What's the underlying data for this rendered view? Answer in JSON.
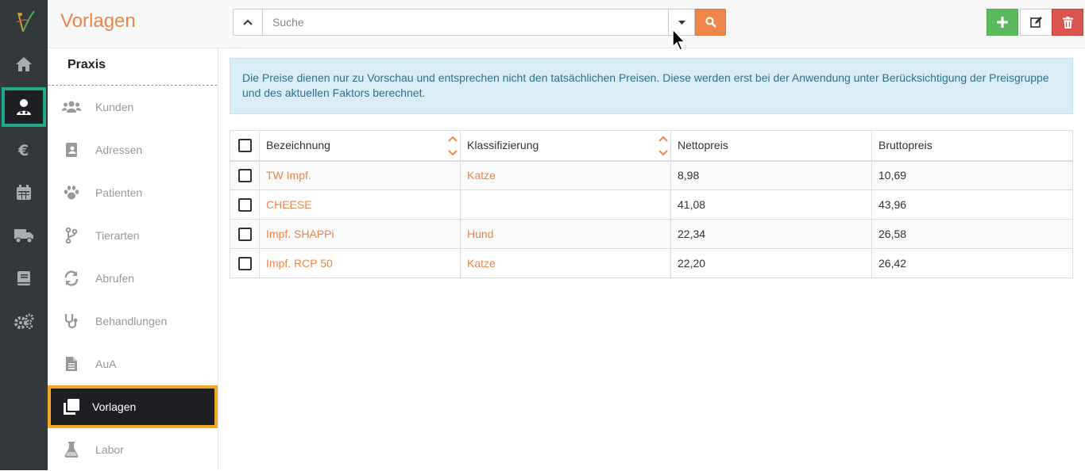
{
  "header": {
    "title": "Vorlagen",
    "search_placeholder": "Suche"
  },
  "rail": {
    "items": [
      "logo",
      "home-icon",
      "user-medic-icon",
      "euro-icon",
      "calendar-icon",
      "truck-icon",
      "book-icon",
      "cogs-icon"
    ],
    "active": "user-medic-icon",
    "active_color": "#1fa88a"
  },
  "subnav": {
    "title": "Praxis",
    "items": [
      {
        "label": "Kunden",
        "icon": "users-icon"
      },
      {
        "label": "Adressen",
        "icon": "address-card-icon"
      },
      {
        "label": "Patienten",
        "icon": "paw-icon"
      },
      {
        "label": "Tierarten",
        "icon": "code-branch-icon"
      },
      {
        "label": "Abrufen",
        "icon": "sync-icon"
      },
      {
        "label": "Behandlungen",
        "icon": "stethoscope-icon"
      },
      {
        "label": "AuA",
        "icon": "file-icon"
      },
      {
        "label": "Vorlagen",
        "icon": "clone-icon"
      },
      {
        "label": "Labor",
        "icon": "flask-icon"
      }
    ],
    "active": "Vorlagen",
    "active_color": "#f5a623"
  },
  "info_text": "Die Preise dienen nur zu Vorschau und entsprechen nicht den tatsächlichen Preisen. Diese werden erst bei der Anwendung unter Berücksichtigung der Preisgruppe und des aktuellen Faktors berechnet.",
  "table": {
    "columns": [
      "Bezeichnung",
      "Klassifizierung",
      "Nettopreis",
      "Bruttopreis"
    ],
    "rows": [
      {
        "bezeichnung": "TW Impf.",
        "klassifizierung": "Katze",
        "netto": "8,98",
        "brutto": "10,69"
      },
      {
        "bezeichnung": "CHEESE",
        "klassifizierung": "",
        "netto": "41,08",
        "brutto": "43,96"
      },
      {
        "bezeichnung": "Impf. SHAPPi",
        "klassifizierung": "Hund",
        "netto": "22,34",
        "brutto": "26,58"
      },
      {
        "bezeichnung": "Impf. RCP 50",
        "klassifizierung": "Katze",
        "netto": "22,20",
        "brutto": "26,42"
      }
    ]
  },
  "colors": {
    "accent": "#f0854a",
    "add_button": "#5cb85c",
    "delete_button": "#d9534f",
    "info_bg": "#d9edf7"
  }
}
